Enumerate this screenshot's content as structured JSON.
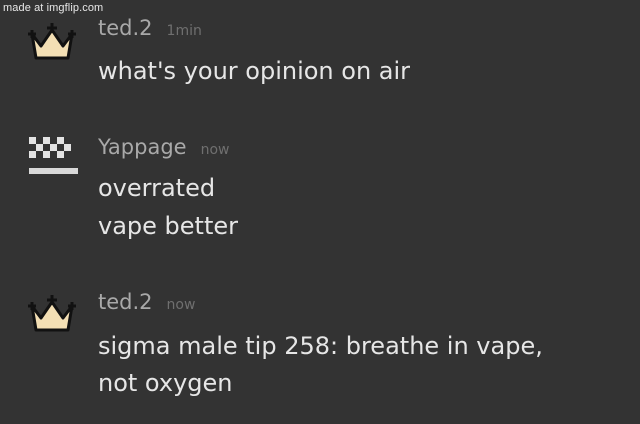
{
  "watermark": "made at imgflip.com",
  "messages": [
    {
      "username": "ted.2",
      "time": "1min",
      "avatar_icon": "crown-icon",
      "lines": [
        "what's your opinion on air"
      ]
    },
    {
      "username": "Yappage",
      "time": "now",
      "avatar_icon": "checkered-block-icon",
      "lines": [
        "overrated",
        "vape better"
      ]
    },
    {
      "username": "ted.2",
      "time": "now",
      "avatar_icon": "crown-icon",
      "lines": [
        "sigma male tip 258: breathe in vape,",
        "not oxygen"
      ]
    }
  ],
  "colors": {
    "background": "#333333",
    "username": "#a9a9a9",
    "timestamp": "#6f6f6f",
    "message_text": "#e6e6e6",
    "crown_fill": "#f3dfb4"
  }
}
